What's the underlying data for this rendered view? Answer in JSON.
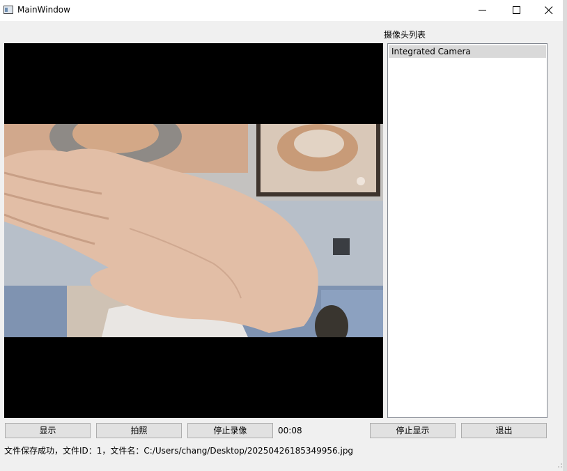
{
  "window": {
    "title": "MainWindow"
  },
  "camera_panel": {
    "label": "摄像头列表",
    "items": [
      {
        "label": "Integrated Camera",
        "selected": true
      }
    ]
  },
  "controls": {
    "show_label": "显示",
    "photo_label": "拍照",
    "record_label": "停止录像",
    "timer": "00:08",
    "stop_display_label": "停止显示",
    "exit_label": "退出"
  },
  "status": {
    "message": "文件保存成功，文件ID：1，文件名：C:/Users/chang/Desktop/20250426185349956.jpg"
  },
  "colors": {
    "window_bg": "#f0f0f0",
    "video_bg": "#000000",
    "selected_item_bg": "#d9d9d9",
    "button_bg": "#e1e1e1"
  }
}
